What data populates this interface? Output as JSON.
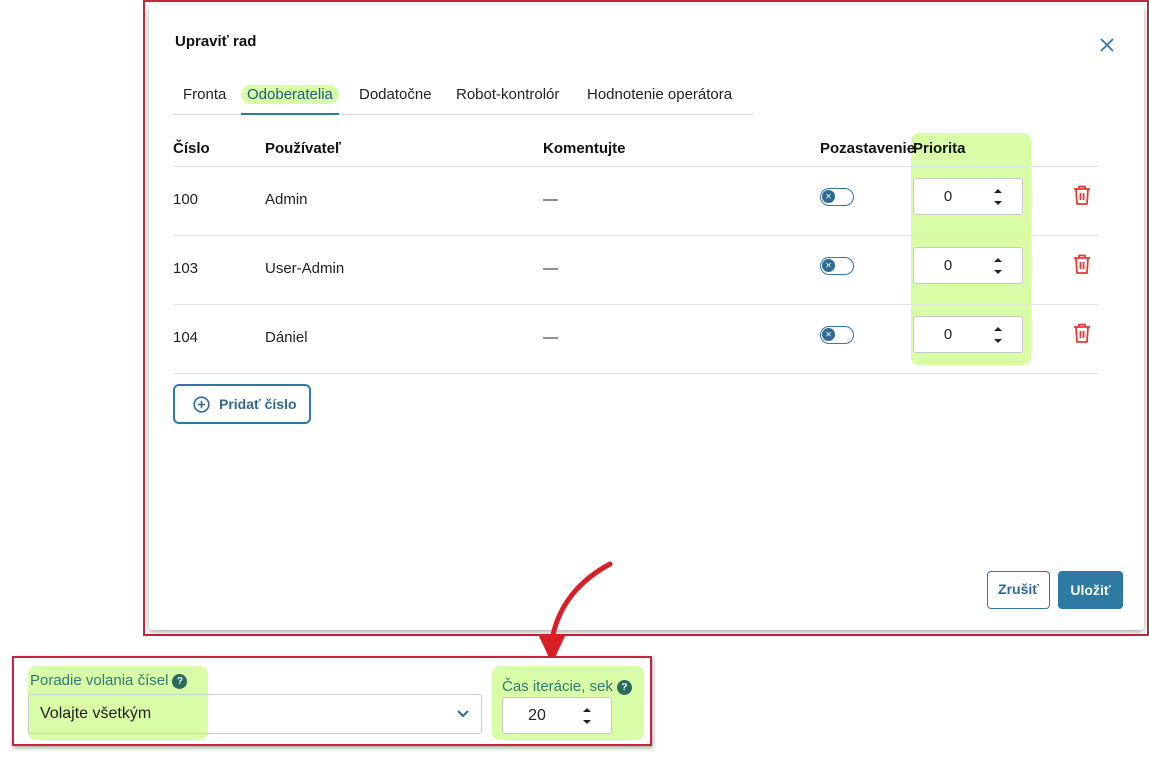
{
  "dialog": {
    "title": "Upraviť rad",
    "tabs": [
      {
        "label": "Fronta"
      },
      {
        "label": "Odoberatelia",
        "active": true
      },
      {
        "label": "Dodatočne"
      },
      {
        "label": "Robot-kontrolór"
      },
      {
        "label": "Hodnotenie operátora"
      }
    ],
    "table": {
      "headers": [
        "Číslo",
        "Používateľ",
        "Komentujte",
        "Pozastavenie",
        "Priorita"
      ],
      "rows": [
        {
          "number": "100",
          "user": "Admin",
          "comment": "—",
          "priority": "0"
        },
        {
          "number": "103",
          "user": "User-Admin",
          "comment": "—",
          "priority": "0"
        },
        {
          "number": "104",
          "user": "Dániel",
          "comment": "—",
          "priority": "0"
        }
      ]
    },
    "add_button": "Pridať číslo",
    "cancel_button": "Zrušiť",
    "save_button": "Uložiť"
  },
  "settings": {
    "call_order_label": "Poradie volania čísel",
    "call_order_value": "Volajte všetkým",
    "iteration_label": "Čas iterácie, sek",
    "iteration_value": "20",
    "help_glyph": "?"
  },
  "colors": {
    "highlight": "#d9fca6",
    "accent": "#2e7aa3",
    "frame": "#c4263f",
    "delete": "#e53935"
  },
  "icons": {
    "close": "close-icon",
    "delete": "trash-icon",
    "spinner": "spinner-arrows-icon",
    "add": "plus-circle-icon",
    "dropdown": "chevron-down-icon",
    "help": "help-icon"
  }
}
